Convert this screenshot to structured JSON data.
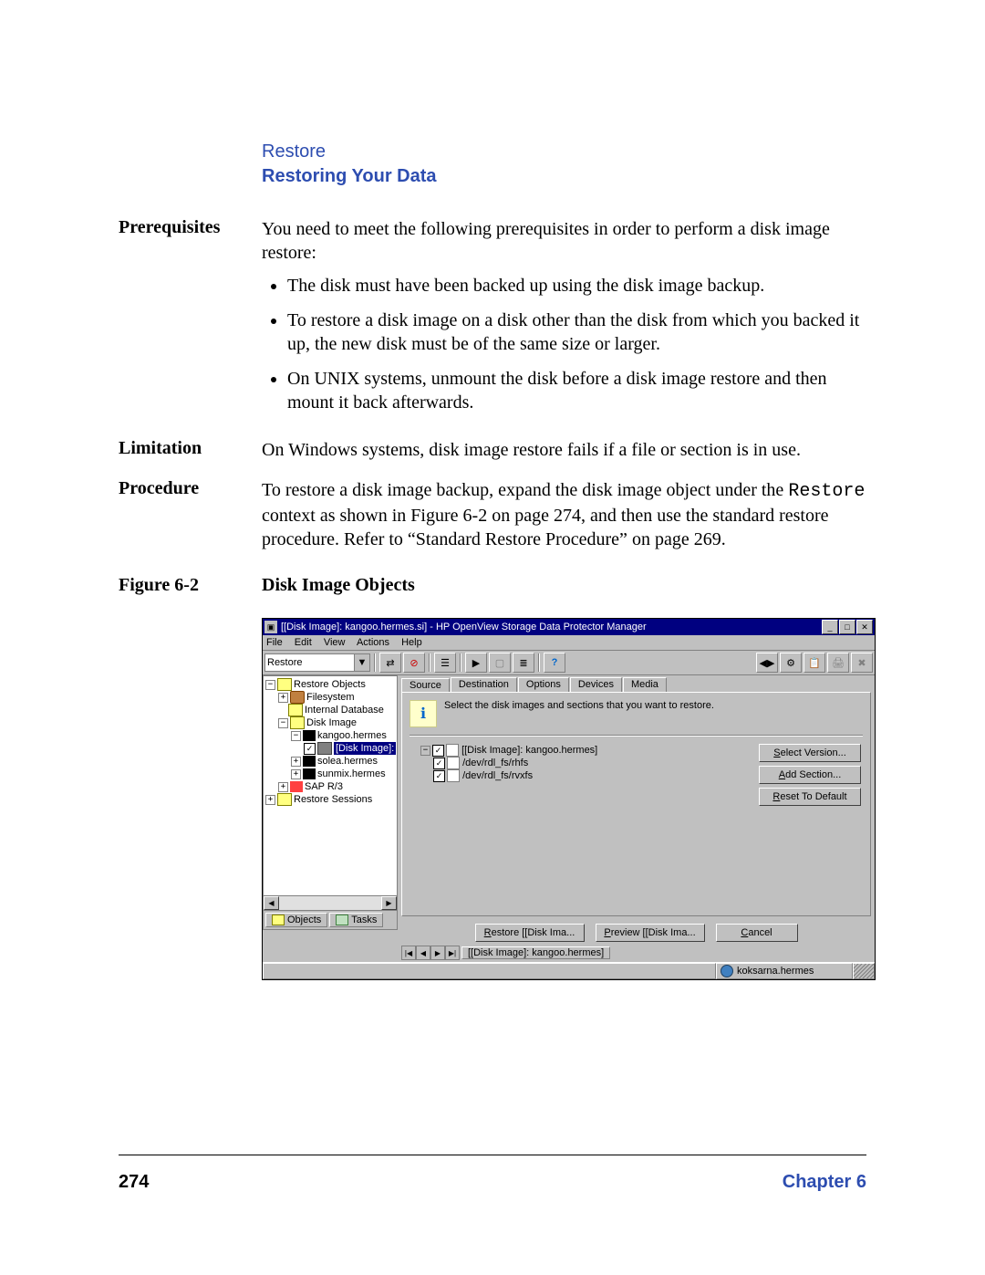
{
  "header": {
    "line1": "Restore",
    "line2": "Restoring Your Data"
  },
  "sections": {
    "prereq_label": "Prerequisites",
    "prereq_intro": "You need to meet the following prerequisites in order to perform a disk image restore:",
    "bullets": [
      "The disk must have been backed up using the disk image backup.",
      "To restore a disk image on a disk other than the disk from which you backed it up, the new disk must be of the same size or larger.",
      "On UNIX systems, unmount the disk before a disk image restore and then mount it back afterwards."
    ],
    "limitation_label": "Limitation",
    "limitation_text": "On Windows systems, disk image restore fails if a file or section is in use.",
    "procedure_label": "Procedure",
    "procedure_text_1": "To restore a disk image backup, expand the disk image object under the ",
    "procedure_mono": "Restore",
    "procedure_text_2": " context as shown in Figure 6-2 on page 274, and then use the standard restore procedure. Refer to “Standard Restore Procedure” on page 269.",
    "figure_label": "Figure 6-2",
    "figure_title": "Disk Image Objects"
  },
  "window": {
    "title": "[[Disk Image]: kangoo.hermes.si] - HP OpenView Storage Data Protector Manager",
    "menus": [
      "File",
      "Edit",
      "View",
      "Actions",
      "Help"
    ],
    "context": "Restore",
    "help_glyph": "?",
    "left_tree": {
      "root": "Restore Objects",
      "filesystem": "Filesystem",
      "internal_db": "Internal Database",
      "disk_image": "Disk Image",
      "kangoo": "kangoo.hermes",
      "disk_image_sel": "[Disk Image]:",
      "solea": "solea.hermes",
      "sunmix": "sunmix.hermes",
      "sap": "SAP R/3",
      "sessions": "Restore Sessions"
    },
    "left_tabs": {
      "objects": "Objects",
      "tasks": "Tasks"
    },
    "tabs": [
      "Source",
      "Destination",
      "Options",
      "Devices",
      "Media"
    ],
    "instruction": "Select the disk images and sections that you want to restore.",
    "src_tree": {
      "root": "[[Disk Image]: kangoo.hermes]",
      "dev1": "/dev/rdl_fs/rhfs",
      "dev2": "/dev/rdl_fs/rvxfs"
    },
    "right_buttons": {
      "select_version": "Select Version...",
      "add_section": "Add Section...",
      "reset": "Reset To Default"
    },
    "bottom_buttons": {
      "restore": "Restore [[Disk Ima...",
      "preview": "Preview [[Disk Ima...",
      "cancel": "Cancel"
    },
    "nav_tab": "[[Disk Image]: kangoo.hermes]",
    "status_host": "koksarna.hermes"
  },
  "footer": {
    "page": "274",
    "chapter": "Chapter 6"
  }
}
